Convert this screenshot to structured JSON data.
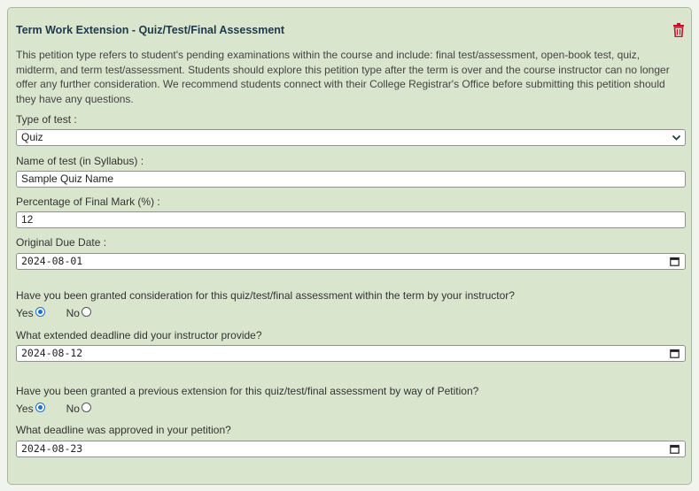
{
  "card": {
    "title": "Term Work Extension - Quiz/Test/Final Assessment",
    "description": "This petition type refers to student's pending examinations within the course and include: final test/assessment, open-book test, quiz, midterm, and term test/assessment. Students should explore this petition type after the term is over and the course instructor can no longer offer any further consideration. We recommend students connect with their College Registrar's Office before submitting this petition should they have any questions.",
    "delete_icon": "trash-icon",
    "accent_color": "#c8102e"
  },
  "form": {
    "type_of_test": {
      "label": "Type of test :",
      "value": "Quiz"
    },
    "name_of_test": {
      "label": "Name of test (in Syllabus) :",
      "value": "Sample Quiz Name"
    },
    "percentage": {
      "label": "Percentage of Final Mark (%) :",
      "value": "12"
    },
    "original_due_date": {
      "label": "Original Due Date :",
      "value": "2024-08-01"
    },
    "instructor_consideration": {
      "question": "Have you been granted consideration for this quiz/test/final assessment within the term by your instructor?",
      "yes_label": "Yes",
      "no_label": "No",
      "selected": "Yes"
    },
    "instructor_deadline": {
      "label": "What extended deadline did your instructor provide?",
      "value": "2024-08-12"
    },
    "previous_extension": {
      "question": "Have you been granted a previous extension for this quiz/test/final assessment by way of Petition?",
      "yes_label": "Yes",
      "no_label": "No",
      "selected": "Yes"
    },
    "petition_deadline": {
      "label": "What deadline was approved in your petition?",
      "value": "2024-08-23"
    }
  }
}
